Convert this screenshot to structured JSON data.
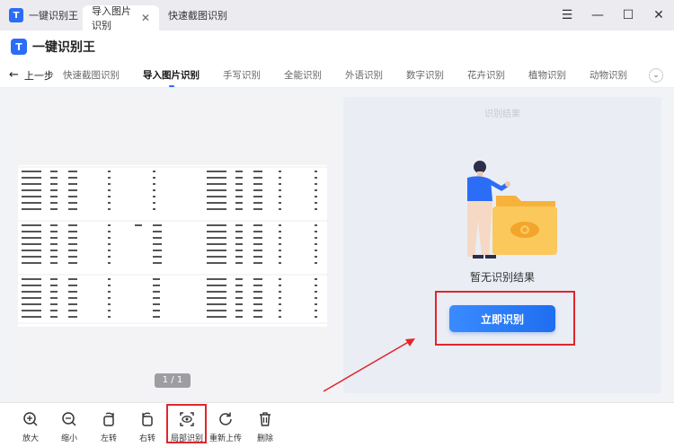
{
  "window": {
    "app_title": "一键识别王",
    "tabs": [
      {
        "label": "导入图片识别",
        "active": true
      },
      {
        "label": "快速截图识别",
        "active": false
      }
    ],
    "controls": {
      "menu": "☰",
      "minimize": "—",
      "maximize": "☐",
      "close": "✕"
    }
  },
  "header": {
    "logo_glyph": "T",
    "title": "一键识别王"
  },
  "nav": {
    "back_label": "上一步",
    "items": [
      "快速截图识别",
      "导入图片识别",
      "手写识别",
      "全能识别",
      "外语识别",
      "数字识别",
      "花卉识别",
      "植物识别",
      "动物识别"
    ],
    "active_index": 1
  },
  "preview": {
    "page_indicator": "1 / 1"
  },
  "result": {
    "title": "识别结果",
    "empty_text": "暂无识别结果",
    "start_button": "立即识别"
  },
  "toolbar": {
    "items": [
      {
        "label": "放大",
        "icon": "zoom-in-icon"
      },
      {
        "label": "缩小",
        "icon": "zoom-out-icon"
      },
      {
        "label": "左转",
        "icon": "rotate-left-icon"
      },
      {
        "label": "右转",
        "icon": "rotate-right-icon"
      },
      {
        "label": "局部识别",
        "icon": "partial-recognize-icon"
      },
      {
        "label": "重新上传",
        "icon": "reupload-icon"
      },
      {
        "label": "删除",
        "icon": "trash-icon"
      }
    ]
  },
  "colors": {
    "accent": "#2b6df6",
    "annotation": "#e0262c",
    "result_bg": "#eaedf4"
  }
}
